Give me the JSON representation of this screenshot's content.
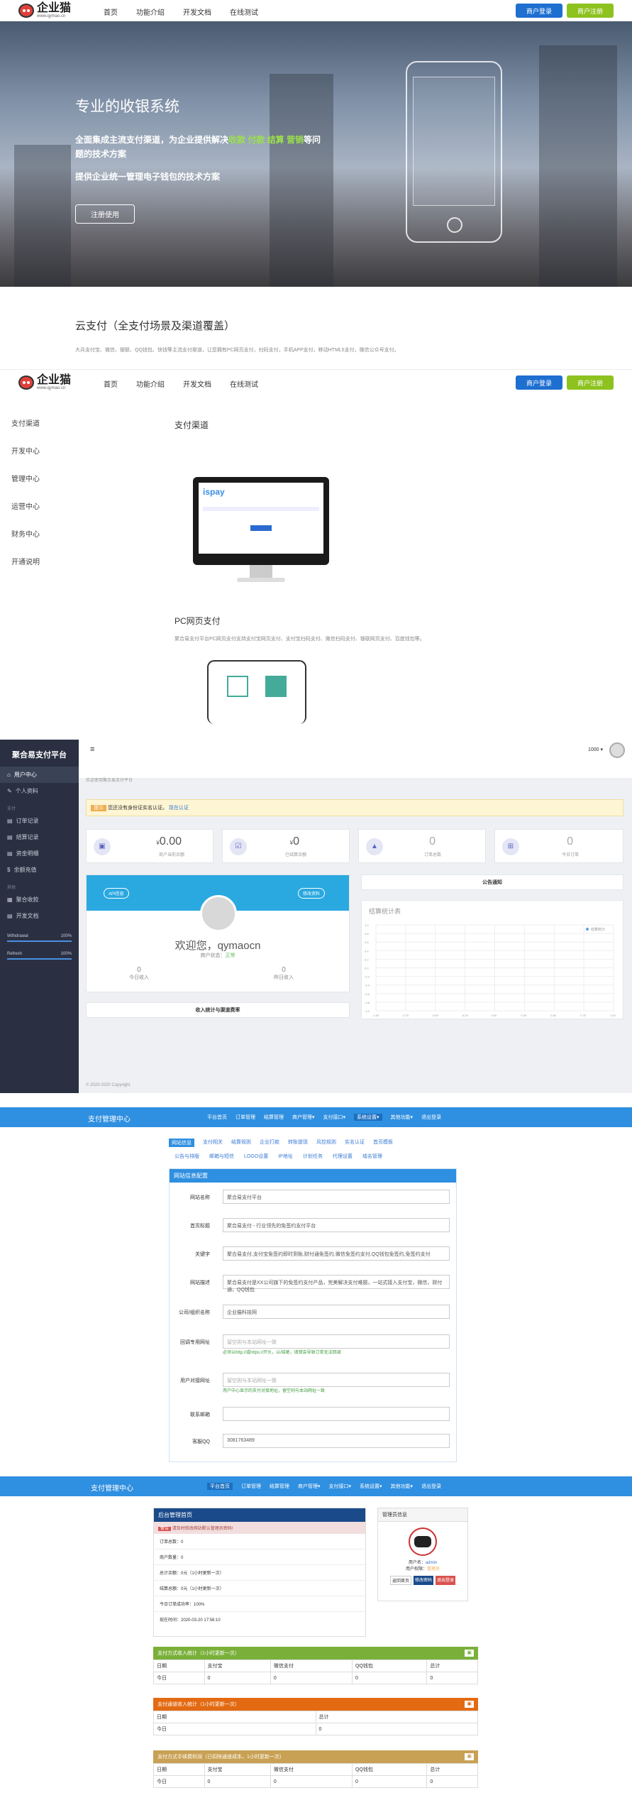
{
  "site": {
    "logo_text": "企业猫",
    "logo_url": "www.qymao.cn",
    "nav": [
      "首页",
      "功能介绍",
      "开发文档",
      "在线测试"
    ],
    "login": "商户登录",
    "register": "商户注册"
  },
  "hero": {
    "title": "专业的收银系统",
    "line1_a": "全面集成主流支付渠道，为企业提供解决",
    "line1_b": "收款 付款 结算 营销",
    "line1_c": "等问",
    "line2": "题的技术方案",
    "line3": "提供企业统一管理电子钱包的技术方案",
    "cta": "注册使用"
  },
  "cloud": {
    "title": "云支付（全支付场景及渠道覆盖）",
    "desc": "大兵支付宝、微信、银联、QQ钱包、快钱等主流支付渠道，让您拥有PC网页支付，扫码支付，手机APP支付，移动HTML5支付，微信公众号支付。"
  },
  "doc": {
    "sidebar": [
      "支付渠道",
      "开发中心",
      "管理中心",
      "运营中心",
      "财务中心",
      "开通说明"
    ],
    "section_title": "支付渠道",
    "ispay": "ispay",
    "pc_title": "PC网页支付",
    "pc_desc": "聚合易支付平台PC网页支付支持支付宝网页支付、支付宝扫码支付、微信扫码支付、银联网页支付、百度钱包等。"
  },
  "admin": {
    "brand": "聚合易支付平台",
    "menu": [
      {
        "label": "用户中心",
        "icon": "home-icon"
      },
      {
        "label": "个人资料",
        "icon": "user-icon"
      }
    ],
    "section_1": "支付",
    "menu2": [
      "订单记录",
      "结算记录",
      "资金明细",
      "余额充值"
    ],
    "section_2": "其他",
    "menu3": [
      "聚合收款",
      "开发文档"
    ],
    "progress": [
      {
        "label": "Withdrawal",
        "value": "100%"
      },
      {
        "label": "Refresh",
        "value": "100%"
      }
    ],
    "breadcrumb": "欢迎使用聚合易支付平台",
    "notice_badge": "提示",
    "notice": "您还没有身份证实名认证。",
    "notice_link": "现在认证",
    "user_dropdown": "1000 ▾",
    "stats": [
      {
        "value": "0.00",
        "label": "商户当前余额",
        "prefix": "¥"
      },
      {
        "value": "0",
        "label": "已结算余额",
        "prefix": "¥"
      },
      {
        "value": "0",
        "label": "订单总数",
        "prefix": ""
      },
      {
        "value": "0",
        "label": "今日订单",
        "prefix": ""
      }
    ],
    "api_btn": "API信息",
    "edit_btn": "修改资料",
    "welcome": "欢迎您，qymaocn",
    "status_label": "商户状态：",
    "status_value": "正常",
    "today_income": "0",
    "today_income_label": "今日收入",
    "yesterday_income": "0",
    "yesterday_income_label": "昨日收入",
    "income_btn": "收入统计与渠道费率",
    "announce": "公告通知",
    "chart_title": "结算统计表",
    "chart_legend": "结算统计",
    "footer": "© 2020-2020 Copyright."
  },
  "chart_data": {
    "type": "line",
    "title": "结算统计表",
    "x": [
      "-1.00",
      "-0.75",
      "-0.50",
      "-0.25",
      "0.00",
      "0.25",
      "0.50",
      "0.75",
      "1.00"
    ],
    "y_ticks": [
      "1.0",
      "0.8",
      "0.6",
      "0.4",
      "0.2",
      "0.0",
      "-0.2",
      "-0.4",
      "-0.6",
      "-0.8",
      "-1.0"
    ],
    "series": [
      {
        "name": "结算统计",
        "values": []
      }
    ]
  },
  "sys": {
    "title": "支付管理中心",
    "nav": [
      "平台首页",
      "订单管理",
      "结算管理",
      "商户管理▾",
      "支付接口▾",
      "系统设置▾",
      "其他功能▾",
      "退出登录"
    ],
    "tabs1": [
      "网站信息",
      "支付相关",
      "结算规则",
      "企业打款",
      "转账提现",
      "风控规则",
      "实名认证",
      "首页模板"
    ],
    "tabs2": [
      "公告与排版",
      "邮箱与短信",
      "LOGO设置",
      "IP地址",
      "计划任务",
      "代理设置",
      "域名管理"
    ],
    "panel_title": "网站信息配置",
    "fields": [
      {
        "label": "网站名称",
        "value": "聚合易支付平台"
      },
      {
        "label": "首页标题",
        "value": "聚合易支付 - 行业领先的免签约支付平台"
      },
      {
        "label": "关键字",
        "value": "聚合易支付,支付宝免签约即时到账,财付通免签约,微信免签约支付,QQ钱包免签约,免签约支付"
      },
      {
        "label": "网站描述",
        "value": "聚合易支付是XX公司旗下的免签约支付产品，完美解决支付难题，一站式接入支付宝，微信，财付通，QQ钱包"
      },
      {
        "label": "公司/组织名称",
        "value": "企业猫科技网"
      },
      {
        "label": "回调专用网址",
        "value": "留空则与本站网址一致"
      },
      {
        "label": "用户对接网址",
        "value": "留空则与本站网址一致"
      },
      {
        "label": "联系邮箱",
        "value": ""
      },
      {
        "label": "客服QQ",
        "value": "3081763489"
      }
    ],
    "hint1": "必须以http://或https://开头，以/结尾，填错会导致订单无法回调",
    "hint2": "用户中心显示的支付对接地址，留空则与本站网址一致"
  },
  "home": {
    "panel_title": "后台管理首页",
    "alert_badge": "警告",
    "alert": "请及时修改网站默认管理员密码!",
    "rows": [
      "订单总数：0",
      "商户数量：0",
      "总计余额：0元（1小时更新一次）",
      "结算总额：0元（1小时更新一次）",
      "今日订单成功率：100%",
      "现在时间：2020-03-20 17:56:10"
    ],
    "admin_title": "管理员信息",
    "admin_name_label": "用户名：",
    "admin_name": "admin",
    "admin_perm_label": "用户权限：",
    "admin_perm": "管理员",
    "links": [
      "返回首页",
      "修改密码",
      "退出登录"
    ],
    "table1_title": "支付方式收入统计（1小时更新一次）",
    "table1_head": [
      "日期",
      "支付宝",
      "微信支付",
      "QQ钱包",
      "总计"
    ],
    "table1_row": [
      "今日",
      "0",
      "0",
      "0",
      "0"
    ],
    "table2_title": "支付通道收入统计（1小时更新一次）",
    "table2_head": [
      "日期",
      "总计"
    ],
    "table2_row": [
      "今日",
      "0"
    ],
    "table3_title": "支付方式手续费利润（已扣除通道成本，1小时更新一次）",
    "table3_head": [
      "日期",
      "支付宝",
      "微信支付",
      "QQ钱包",
      "总计"
    ],
    "table3_row": [
      "今日",
      "0",
      "0",
      "0",
      "0"
    ]
  },
  "colors": {
    "accent_blue": "#1e6fd0",
    "accent_green": "#8dc21f",
    "highlight": "#9be14b",
    "sys_bar": "#2f8fe0",
    "green_hdr": "#7ab03a",
    "orange_hdr": "#e36a12",
    "tan_hdr": "#c9a154"
  }
}
